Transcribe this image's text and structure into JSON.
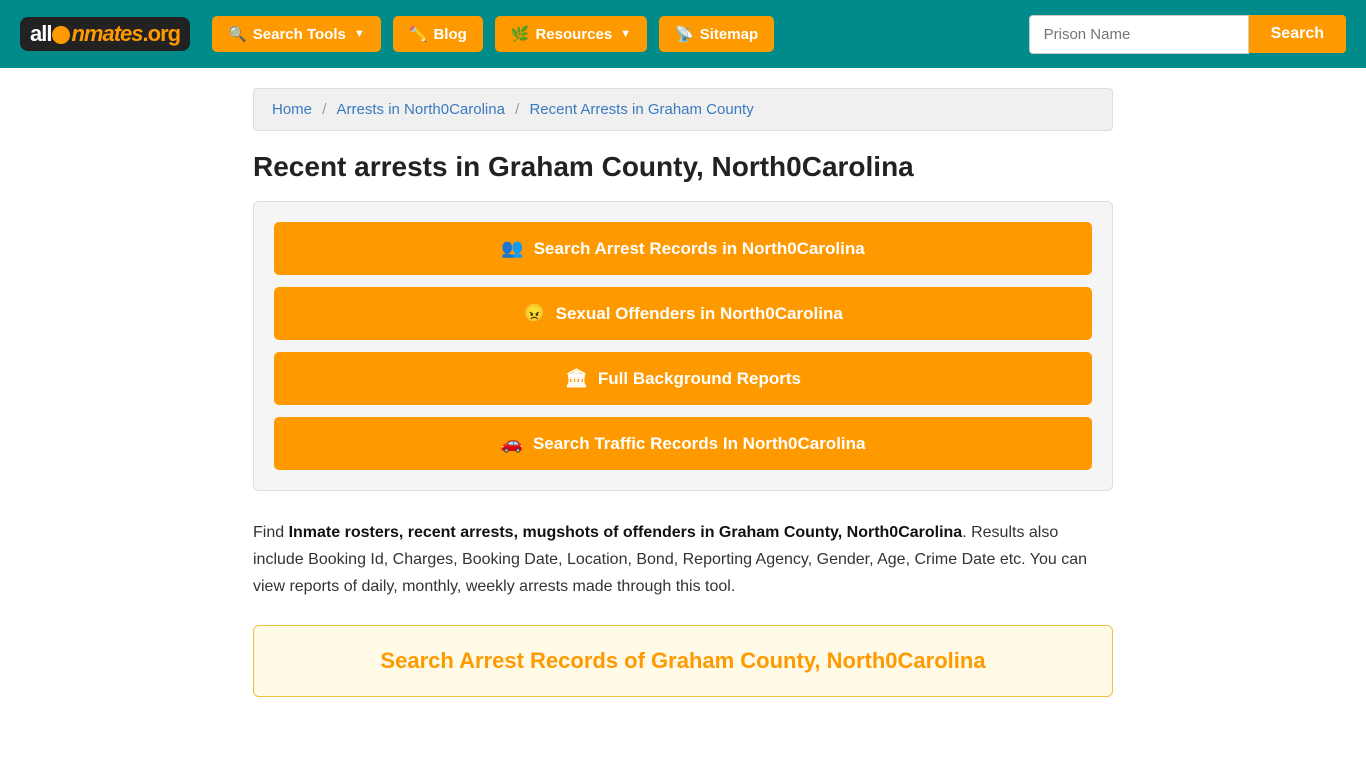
{
  "header": {
    "logo": {
      "text": "allInmates.org"
    },
    "nav": [
      {
        "id": "search-tools",
        "label": "Search Tools",
        "icon": "search-icon",
        "hasDropdown": true
      },
      {
        "id": "blog",
        "label": "Blog",
        "icon": "blog-icon",
        "hasDropdown": false
      },
      {
        "id": "resources",
        "label": "Resources",
        "icon": "resources-icon",
        "hasDropdown": true
      },
      {
        "id": "sitemap",
        "label": "Sitemap",
        "icon": "sitemap-icon",
        "hasDropdown": false
      }
    ],
    "prison_input_placeholder": "Prison Name",
    "search_button_label": "Search"
  },
  "breadcrumb": {
    "home": "Home",
    "arrests": "Arrests in North0Carolina",
    "current": "Recent Arrests in Graham County"
  },
  "page": {
    "title": "Recent arrests in Graham County, North0Carolina",
    "buttons": [
      {
        "id": "arrest-records",
        "label": "Search Arrest Records in North0Carolina",
        "icon": "people-icon"
      },
      {
        "id": "sexual-offenders",
        "label": "Sexual Offenders in North0Carolina",
        "icon": "offender-icon"
      },
      {
        "id": "background-reports",
        "label": "Full Background Reports",
        "icon": "building-icon"
      },
      {
        "id": "traffic-records",
        "label": "Search Traffic Records In North0Carolina",
        "icon": "car-icon"
      }
    ],
    "description_prefix": "Find ",
    "description_bold": "Inmate rosters, recent arrests, mugshots of offenders in Graham County, North0Carolina",
    "description_suffix": ". Results also include Booking Id, Charges, Booking Date, Location, Bond, Reporting Agency, Gender, Age, Crime Date etc. You can view reports of daily, monthly, weekly arrests made through this tool.",
    "search_records_title": "Search Arrest Records of Graham County, North0Carolina"
  },
  "colors": {
    "teal": "#008b8b",
    "orange": "#f90",
    "link_blue": "#3a7abf"
  }
}
